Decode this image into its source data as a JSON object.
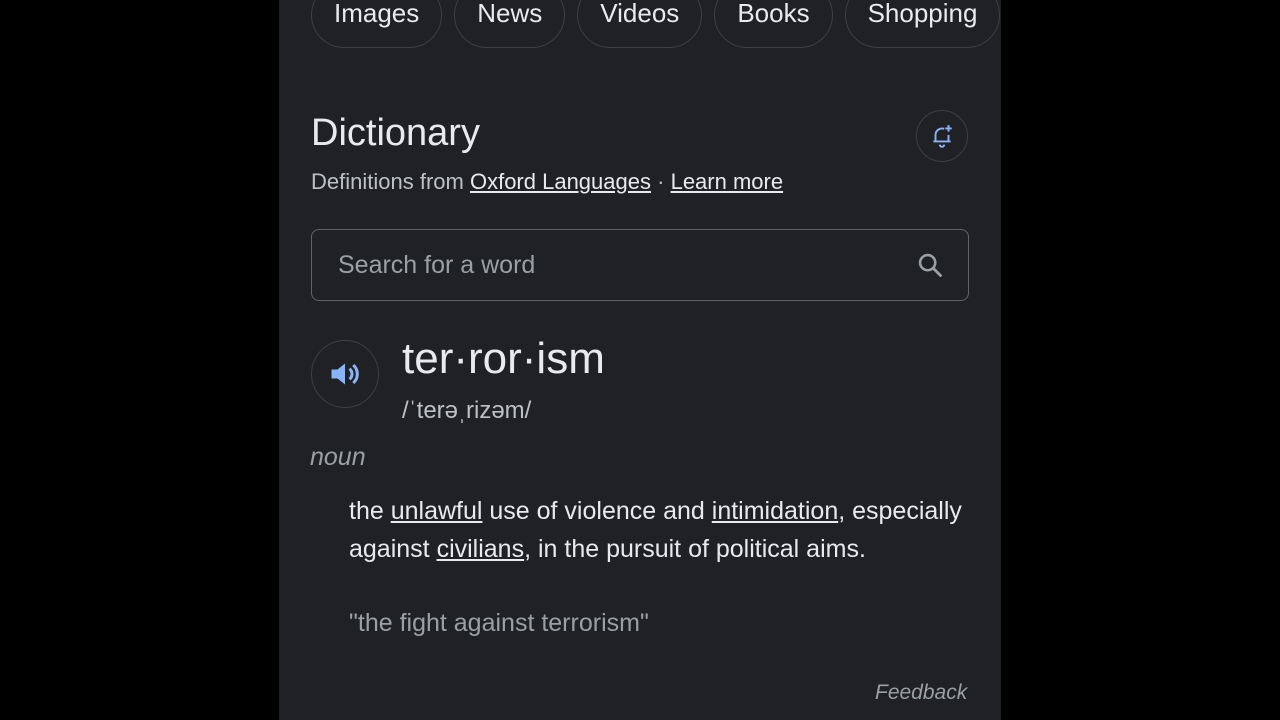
{
  "tabs": [
    "Images",
    "News",
    "Videos",
    "Books",
    "Shopping"
  ],
  "dictionary": {
    "title": "Dictionary",
    "source_prefix": "Definitions from",
    "source_link": "Oxford Languages",
    "separator": "·",
    "learn_more": "Learn more"
  },
  "search": {
    "placeholder": "Search for a word"
  },
  "entry": {
    "headword": "ter·ror·ism",
    "phonetic": "/ˈterəˌrizəm/",
    "part_of_speech": "noun",
    "definition": {
      "t1": "the ",
      "l1": "unlawful",
      "t2": " use of violence and ",
      "l2": "intimidation",
      "t3": ", especially against ",
      "l3": "civilians",
      "t4": ", in the pursuit of political aims."
    },
    "example": "\"the fight against terrorism\""
  },
  "feedback": "Feedback",
  "icons": {
    "bell": "bell-plus-icon",
    "speaker": "speaker-icon",
    "search": "search-icon"
  },
  "colors": {
    "background": "#202124",
    "text": "#e8eaed",
    "muted": "#9aa0a6",
    "accent_blue": "#8ab4f8"
  }
}
